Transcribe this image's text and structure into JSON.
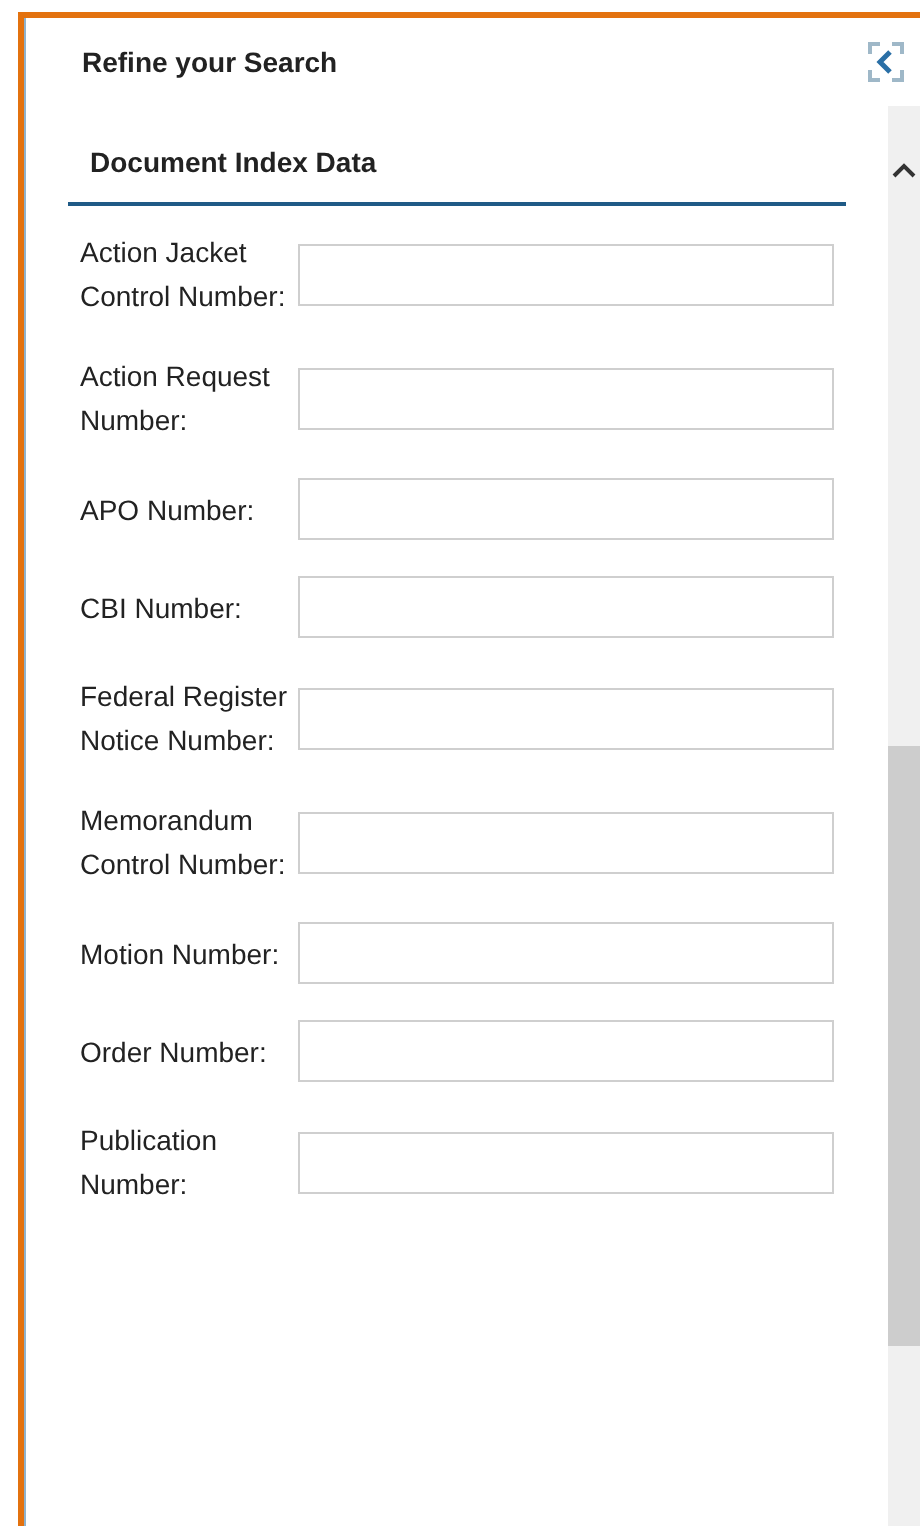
{
  "panel": {
    "title": "Refine your Search"
  },
  "section": {
    "title": "Document Index Data"
  },
  "fields": [
    {
      "label": "Action Jacket Control Number:"
    },
    {
      "label": "Action Request Number:"
    },
    {
      "label": "APO Number:"
    },
    {
      "label": "CBI Number:"
    },
    {
      "label": "Federal Register Notice Number:"
    },
    {
      "label": "Memorandum Control Number:"
    },
    {
      "label": "Motion Number:"
    },
    {
      "label": "Order Number:"
    },
    {
      "label": "Publication Number:"
    }
  ]
}
